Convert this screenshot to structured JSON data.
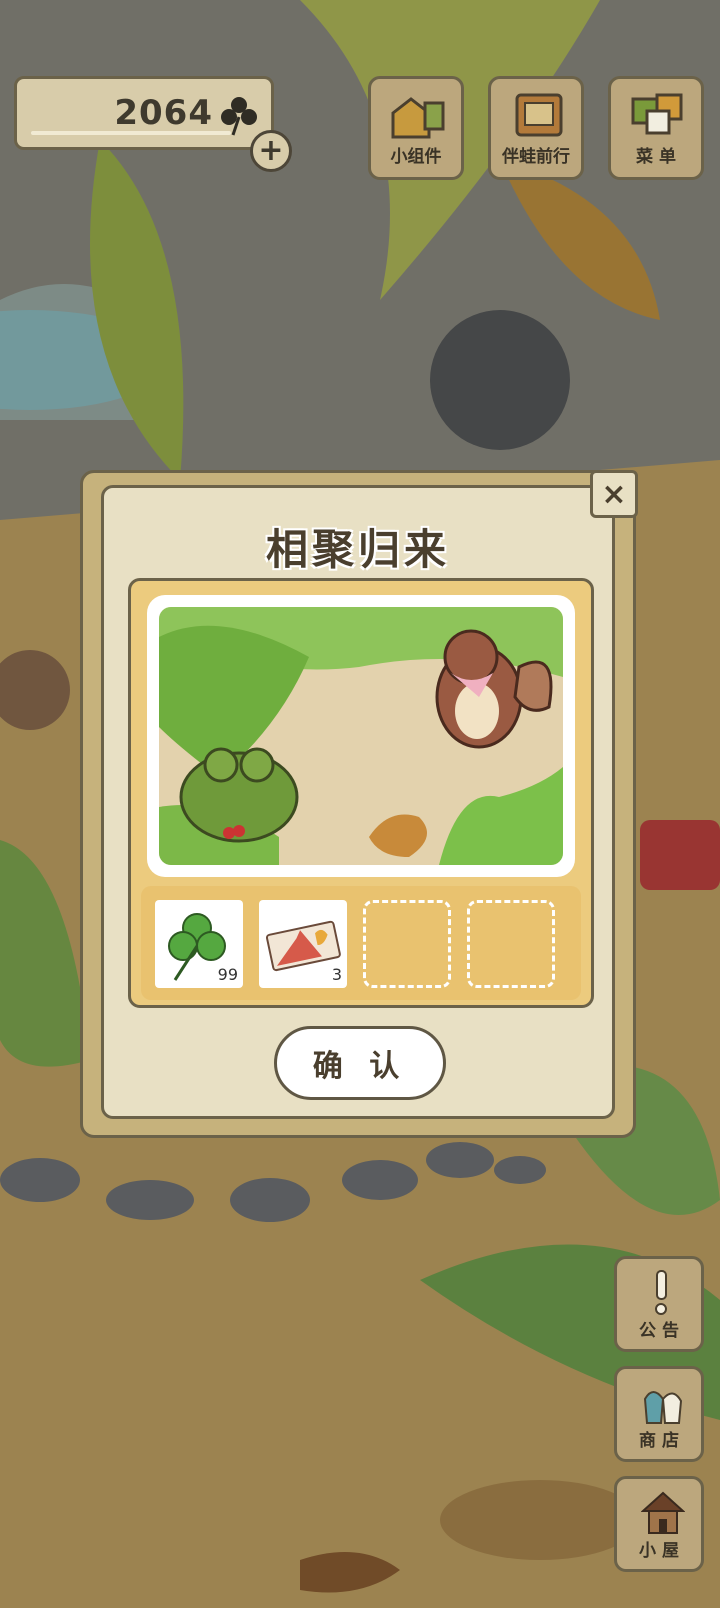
{
  "currency": {
    "clover_count": "2064"
  },
  "top_menu": [
    {
      "label": "小组件"
    },
    {
      "label": "伴蛙前行"
    },
    {
      "label": "菜 单"
    }
  ],
  "side_menu": [
    {
      "label": "公 告"
    },
    {
      "label": "商 店"
    },
    {
      "label": "小 屋"
    }
  ],
  "dialog": {
    "title": "相聚归来",
    "close_symbol": "×",
    "confirm_label": "确 认",
    "items": [
      {
        "icon": "clover-icon",
        "qty": "99"
      },
      {
        "icon": "ticket-icon",
        "qty": "3"
      }
    ],
    "empty_slots": 2
  },
  "colors": {
    "panel": "#e8e0c4",
    "frame": "#eccb7e",
    "border": "#6b6249"
  }
}
